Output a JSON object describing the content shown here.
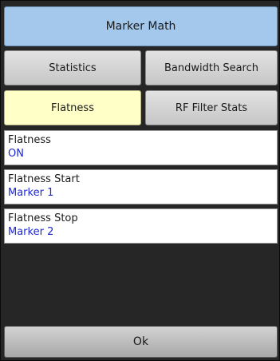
{
  "dialog": {
    "title": "Marker Math"
  },
  "functions": {
    "statistics": "Statistics",
    "bandwidth_search": "Bandwidth Search",
    "flatness": "Flatness",
    "rf_filter_stats": "RF Filter Stats",
    "active": "Flatness"
  },
  "settings": [
    {
      "label": "Flatness",
      "value": "ON"
    },
    {
      "label": "Flatness Start",
      "value": "Marker 1"
    },
    {
      "label": "Flatness Stop",
      "value": "Marker 2"
    }
  ],
  "ok_label": "Ok",
  "colors": {
    "title_bg": "#a4c8ec",
    "active_bg": "#ffffc8",
    "value_text": "#1e28d2",
    "panel_bg": "#262626"
  }
}
